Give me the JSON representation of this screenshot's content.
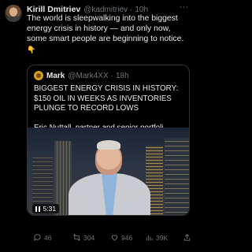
{
  "post": {
    "author_name": "Kirill Dmitriev",
    "author_handle": "@kadmitriev",
    "time": "10h",
    "more": "···",
    "text": "The world is sleepwalking into the biggest energy crisis in history — and only now, some smart people are beginning to notice.",
    "emoji": "👇"
  },
  "quote": {
    "author_name": "Mark",
    "author_handle": "@Mark4XX",
    "time": "18h",
    "headline": "BIGGEST ENERGY CRISIS IN HISTORY: $150 OIL IN WEEKS AS INVENTORIES PLUNGE TO RECORD LOWS",
    "subline": "Eric Nuttall, partner and senior portfoli...",
    "video_duration": "5:31"
  },
  "actions": {
    "replies": "46",
    "retweets": "304",
    "likes": "946",
    "views": "39K"
  },
  "colors": {
    "background": "#000000",
    "text": "#e7e9ea",
    "muted": "#71767b",
    "border": "#2f3336"
  }
}
